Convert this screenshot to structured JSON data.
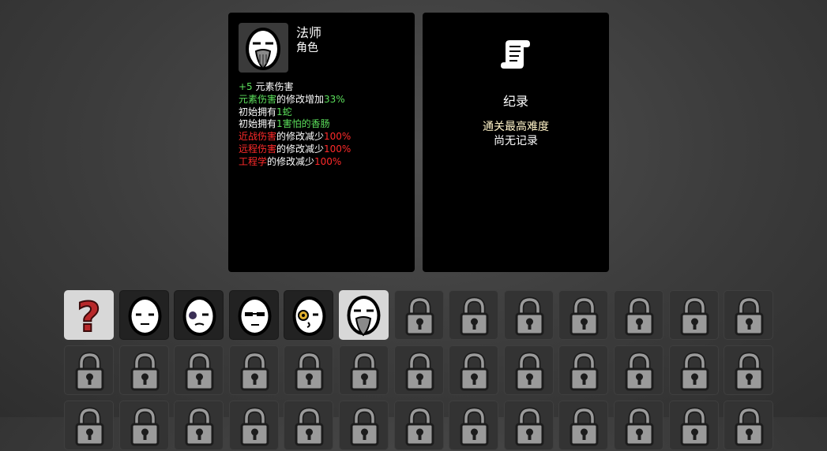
{
  "character": {
    "name": "法师",
    "type": "角色",
    "stats": [
      [
        {
          "t": "+5",
          "c": "g"
        },
        {
          "t": " 元素伤害",
          "c": "w"
        }
      ],
      [
        {
          "t": "元素伤害",
          "c": "g"
        },
        {
          "t": "的修改增加",
          "c": "w"
        },
        {
          "t": "33%",
          "c": "g"
        }
      ],
      [
        {
          "t": "初始拥有",
          "c": "w"
        },
        {
          "t": "1蛇",
          "c": "g"
        }
      ],
      [
        {
          "t": "初始拥有",
          "c": "w"
        },
        {
          "t": "1害怕的香肠",
          "c": "g"
        }
      ],
      [
        {
          "t": "近战伤害",
          "c": "r"
        },
        {
          "t": "的修改减少",
          "c": "w"
        },
        {
          "t": "100%",
          "c": "r"
        }
      ],
      [
        {
          "t": "远程伤害",
          "c": "r"
        },
        {
          "t": "的修改减少",
          "c": "w"
        },
        {
          "t": "100%",
          "c": "r"
        }
      ],
      [
        {
          "t": "工程学",
          "c": "r"
        },
        {
          "t": "的修改减少",
          "c": "w"
        },
        {
          "t": "100%",
          "c": "r"
        }
      ]
    ]
  },
  "record": {
    "title": "纪录",
    "label": "通关最高难度",
    "value": "尚无记录"
  },
  "grid": {
    "unlocked": [
      {
        "name": "random",
        "icon": "question-mark-icon",
        "selected": true
      },
      {
        "name": "egg-1",
        "icon": "egg-face-neutral-icon",
        "selected": false
      },
      {
        "name": "egg-2",
        "icon": "egg-face-bruised-icon",
        "selected": false
      },
      {
        "name": "egg-3",
        "icon": "egg-face-sunglasses-icon",
        "selected": false
      },
      {
        "name": "egg-4",
        "icon": "egg-face-eyepatch-icon",
        "selected": false
      },
      {
        "name": "mage",
        "icon": "egg-face-wizard-icon",
        "selected": true
      }
    ],
    "locked_icon": "padlock-icon"
  }
}
